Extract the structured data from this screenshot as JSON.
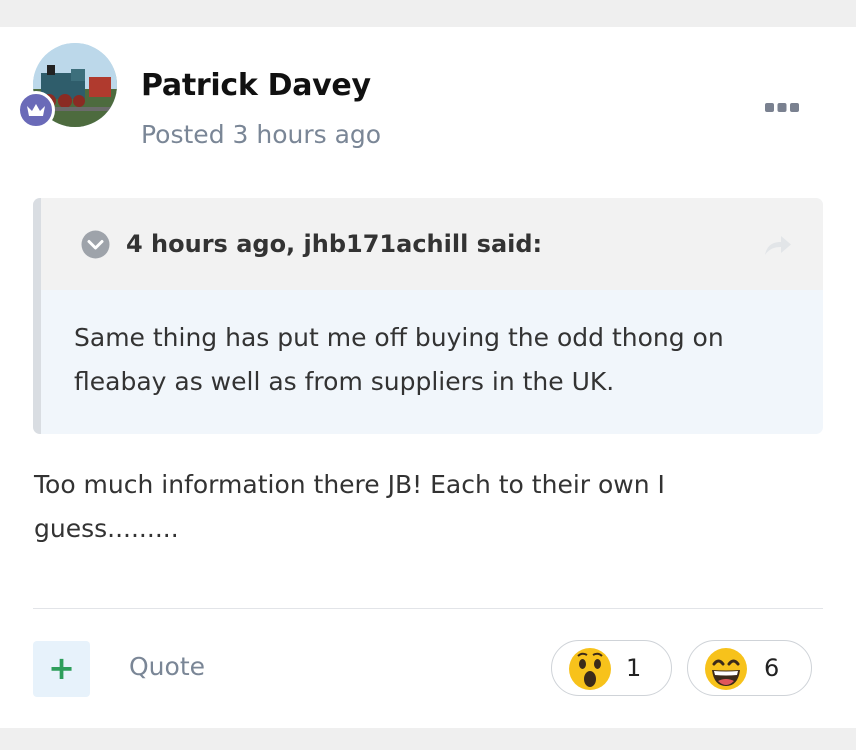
{
  "post": {
    "author": "Patrick Davey",
    "posted": "Posted 3 hours ago",
    "quote": {
      "citation": "4 hours ago, jhb171achill said:",
      "text": "Same thing has put me off buying the odd thong on fleabay as well as from suppliers in the UK."
    },
    "body": "Too much information there JB!  Each to their own I guess........."
  },
  "actions": {
    "rep_symbol": "+",
    "quote_label": "Quote"
  },
  "reactions": [
    {
      "icon": "surprised-face-icon",
      "count": "1"
    },
    {
      "icon": "grinning-face-icon",
      "count": "6"
    }
  ],
  "colors": {
    "rank_badge": "#6a6ab8",
    "rep_plus": "#2e9e5b",
    "emoji_yellow": "#f7c21b"
  }
}
